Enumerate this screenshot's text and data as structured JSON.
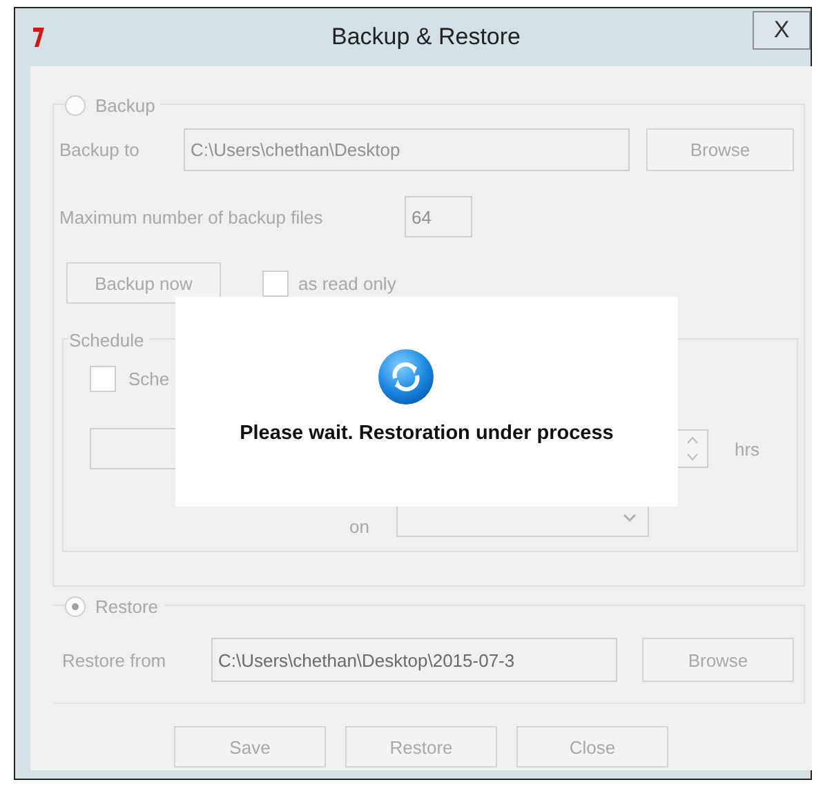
{
  "window": {
    "title": "Backup & Restore",
    "close": "X"
  },
  "form": {
    "disabled": true
  },
  "backup": {
    "label": "Backup",
    "selected": false,
    "backup_to": {
      "label": "Backup to",
      "value": "C:\\Users\\chethan\\Desktop",
      "browse": "Browse"
    },
    "max_files": {
      "label": "Maximum number of backup files",
      "value": "64"
    },
    "backup_now": "Backup now",
    "read_only": {
      "label": "as read only",
      "checked": false
    },
    "schedule": {
      "title": "Schedule",
      "checkbox": {
        "label": "Sche",
        "checked": false
      },
      "hrs": "hrs",
      "on": "on"
    }
  },
  "restore": {
    "label": "Restore",
    "selected": true,
    "restore_from": {
      "label": "Restore from",
      "value": "C:\\Users\\chethan\\Desktop\\2015-07-3",
      "browse": "Browse"
    }
  },
  "buttons": [
    "Save",
    "Restore",
    "Close"
  ],
  "progress": {
    "message": "Please wait. Restoration under process"
  }
}
